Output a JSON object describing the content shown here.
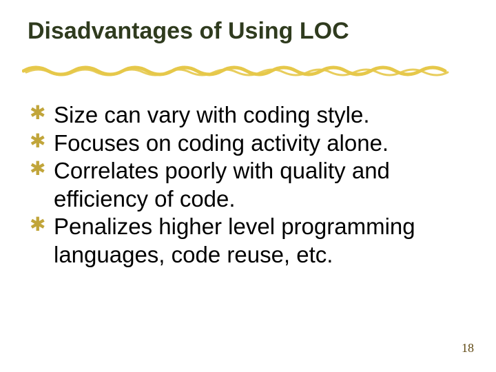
{
  "slide": {
    "title": "Disadvantages of Using LOC",
    "bullets": [
      "Size can vary with coding style.",
      "Focuses on coding activity alone.",
      "Correlates poorly with quality and efficiency of code.",
      "Penalizes higher level programming languages, code reuse, etc."
    ],
    "page_number": "18",
    "colors": {
      "title": "#2f3b1e",
      "bullet_glyph": "#c1a53a",
      "underline": "#e6c84a",
      "page_number": "#614a14"
    }
  }
}
